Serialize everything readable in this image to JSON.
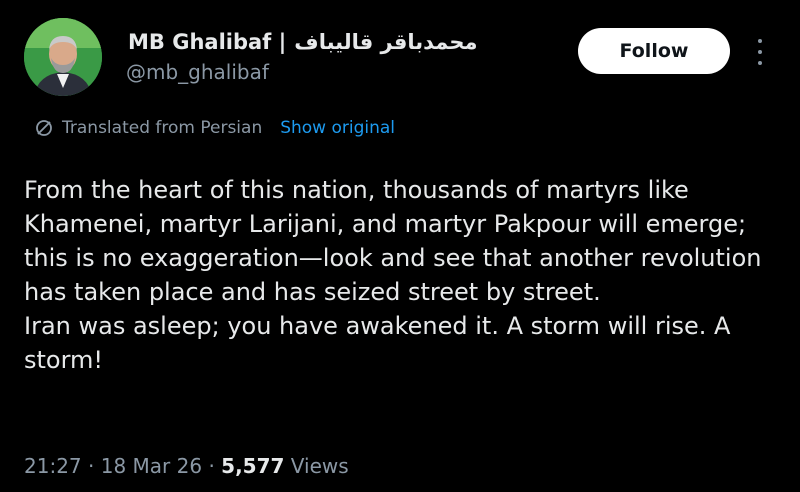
{
  "author": {
    "display_name": "MB Ghalibaf |",
    "display_name_persian": "محمدباقر قالیباف",
    "handle": "@mb_ghalibaf"
  },
  "follow_label": "Follow",
  "translation": {
    "label": "Translated from Persian",
    "show_original": "Show original"
  },
  "tweet": {
    "paragraph_1": "From the heart of this nation, thousands of martyrs like Khamenei, martyr Larijani, and martyr Pakpour will emerge; this is no exaggeration—look and see that another revolution has taken place and has seized street by street.",
    "paragraph_2": "Iran was asleep; you have awakened it. A storm will rise. A storm!"
  },
  "meta": {
    "time": "21:27",
    "date": "18 Mar 26",
    "views_count": "5,577",
    "views_label": "Views"
  },
  "colors": {
    "background": "#000000",
    "text": "#e7e9ea",
    "muted": "#8b98a5",
    "link": "#1d9bf0",
    "button_bg": "#ffffff"
  },
  "icons": {
    "more": "more-vertical-icon",
    "translate": "globe-slash-icon"
  }
}
